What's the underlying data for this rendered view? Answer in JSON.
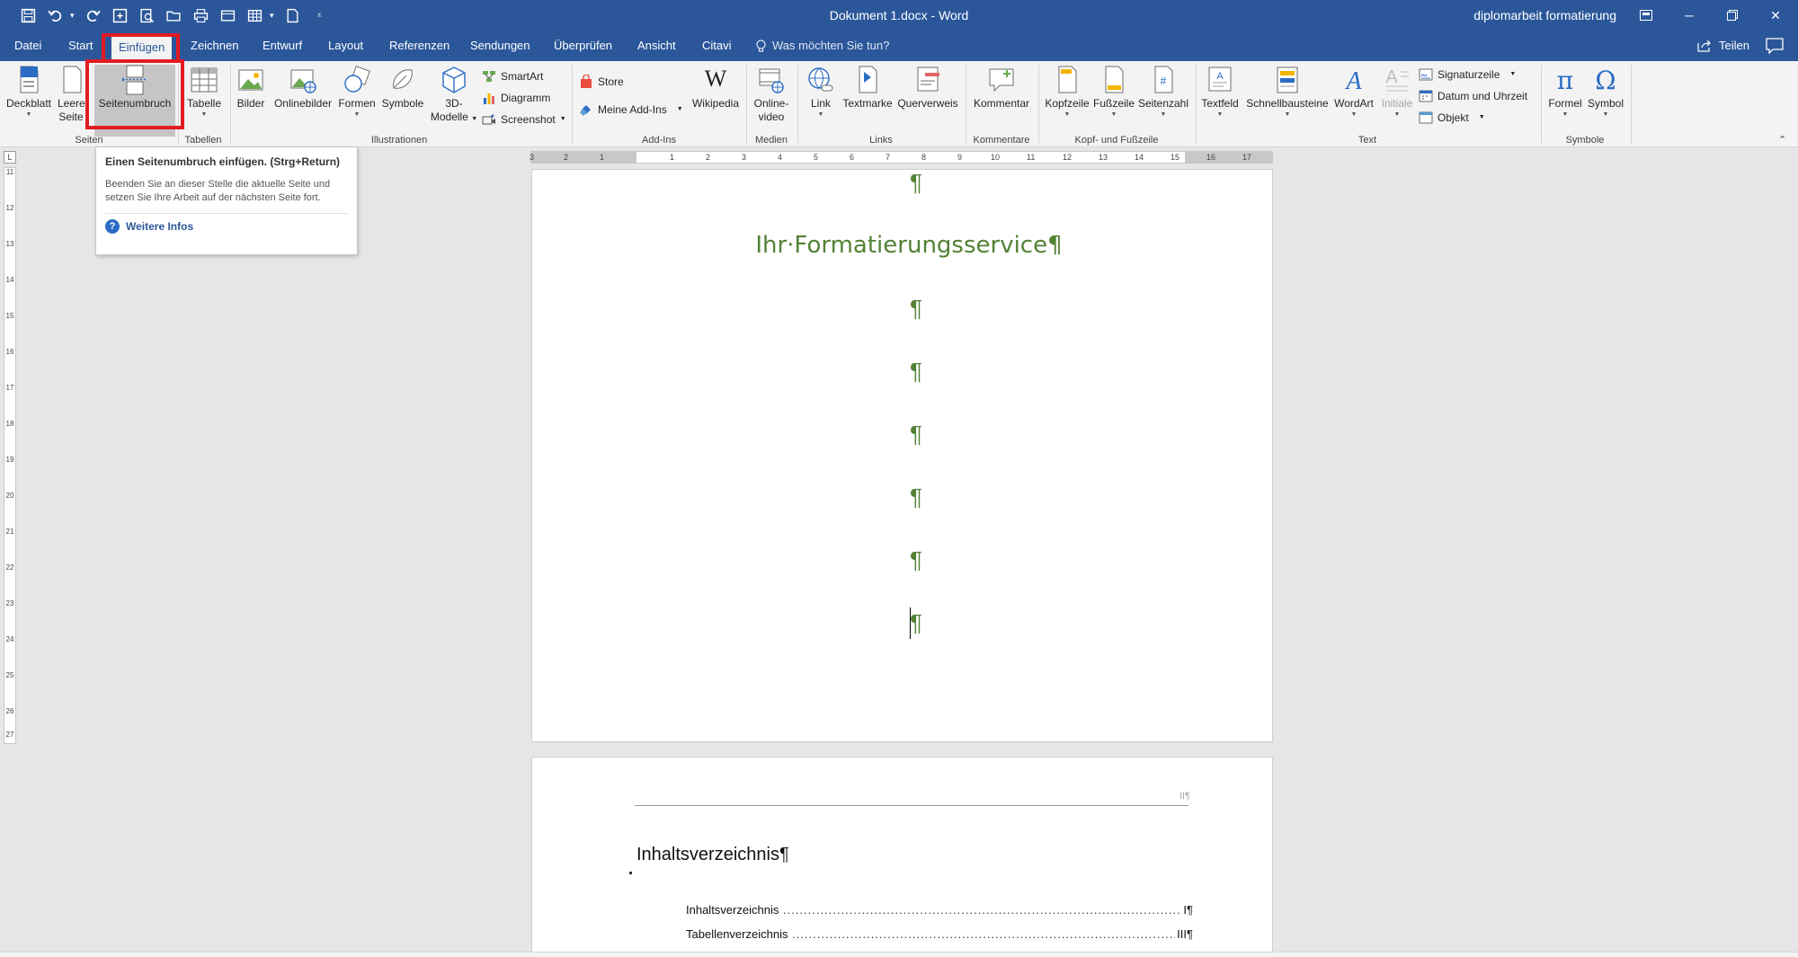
{
  "window": {
    "title": "Dokument 1.docx  -  Word",
    "user": "diplomarbeit formatierung"
  },
  "tabs": [
    "Datei",
    "Start",
    "Einfügen",
    "Zeichnen",
    "Entwurf",
    "Layout",
    "Referenzen",
    "Sendungen",
    "Überprüfen",
    "Ansicht",
    "Citavi"
  ],
  "tell_me": "Was möchten Sie tun?",
  "share": "Teilen",
  "ribbon": {
    "deckblatt": "Deckblatt",
    "leere_seite_1": "Leere",
    "leere_seite_2": "Seite",
    "seitenumbruch": "Seitenumbruch",
    "tabelle": "Tabelle",
    "bilder": "Bilder",
    "onlinebilder": "Onlinebilder",
    "formen": "Formen",
    "symbole": "Symbole",
    "modelle_1": "3D-",
    "modelle_2": "Modelle",
    "smartart": "SmartArt",
    "diagramm": "Diagramm",
    "screenshot": "Screenshot",
    "store": "Store",
    "meine_addins": "Meine Add-Ins",
    "wikipedia": "Wikipedia",
    "onlinevideo_1": "Online-",
    "onlinevideo_2": "video",
    "link": "Link",
    "textmarke": "Textmarke",
    "querverweis": "Querverweis",
    "kommentar": "Kommentar",
    "kopfzeile": "Kopfzeile",
    "fusszeile": "Fußzeile",
    "seitenzahl": "Seitenzahl",
    "textfeld": "Textfeld",
    "schnellbausteine": "Schnellbausteine",
    "wordart": "WordArt",
    "initiale": "Initiale",
    "signaturzeile": "Signaturzeile",
    "datum": "Datum und Uhrzeit",
    "objekt": "Objekt",
    "formel": "Formel",
    "symbol": "Symbol"
  },
  "groups": {
    "seiten": "Seiten",
    "tabellen": "Tabellen",
    "illustrationen": "Illustrationen",
    "addins": "Add-Ins",
    "medien": "Medien",
    "links": "Links",
    "kommentare": "Kommentare",
    "kopf_fusszeile": "Kopf- und Fußzeile",
    "text": "Text",
    "symbole": "Symbole"
  },
  "tooltip": {
    "title": "Einen Seitenumbruch einfügen. (Strg+Return)",
    "body": "Beenden Sie an dieser Stelle die aktuelle Seite und setzen Sie Ihre Arbeit auf der nächsten Seite fort.",
    "more": "Weitere Infos"
  },
  "ruler": {
    "corner": "L",
    "h_labels": [
      "3",
      "2",
      "1",
      "1",
      "2",
      "3",
      "4",
      "5",
      "6",
      "7",
      "8",
      "9",
      "10",
      "11",
      "12",
      "13",
      "14",
      "15",
      "16",
      "17"
    ],
    "v_labels": [
      "11",
      "12",
      "13",
      "14",
      "15",
      "16",
      "17",
      "18",
      "19",
      "20",
      "21",
      "22",
      "23",
      "24",
      "25",
      "26",
      "27"
    ]
  },
  "document": {
    "pilcrow": "¶",
    "heading": "Ihr·Formatierungsservice¶",
    "header_mark": "II¶",
    "toc_title": "Inhaltsverzeichnis¶",
    "toc_entries": [
      {
        "label": "Inhaltsverzeichnis",
        "page": "I¶"
      },
      {
        "label": "Tabellenverzeichnis",
        "page": "III¶"
      }
    ]
  }
}
